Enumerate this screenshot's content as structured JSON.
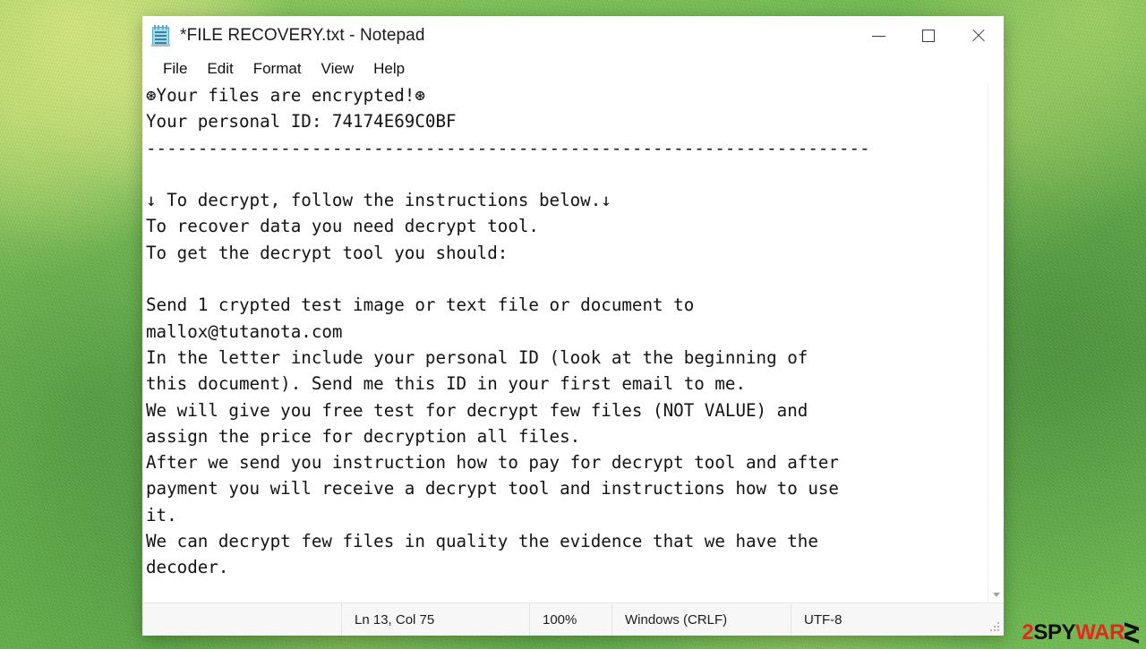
{
  "window": {
    "title": "*FILE RECOVERY.txt - Notepad",
    "icon": "notepad-icon",
    "controls": {
      "minimize": "minimize-icon",
      "maximize": "maximize-icon",
      "close": "close-icon"
    }
  },
  "menubar": {
    "items": [
      {
        "label": "File"
      },
      {
        "label": "Edit"
      },
      {
        "label": "Format"
      },
      {
        "label": "View"
      },
      {
        "label": "Help"
      }
    ]
  },
  "document": {
    "lines": [
      "⊛Your files are encrypted!⊛",
      "Your personal ID: 74174E69C0BF",
      "----------------------------------------------------------------------",
      "",
      "↓ To decrypt, follow the instructions below.↓",
      "To recover data you need decrypt tool.",
      "To get the decrypt tool you should:",
      "",
      "Send 1 crypted test image or text file or document to",
      "mallox@tutanota.com",
      "In the letter include your personal ID (look at the beginning of",
      "this document). Send me this ID in your first email to me.",
      "We will give you free test for decrypt few files (NOT VALUE) and",
      "assign the price for decryption all files.",
      "After we send you instruction how to pay for decrypt tool and after",
      "payment you will receive a decrypt tool and instructions how to use",
      "it.",
      "We can decrypt few files in quality the evidence that we have the",
      "decoder."
    ]
  },
  "statusbar": {
    "position": "Ln 13, Col 75",
    "zoom": "100%",
    "line_ending": "Windows (CRLF)",
    "encoding": "UTF-8"
  },
  "watermark": {
    "part1": "2",
    "part2": "SPY",
    "part3": "WAR",
    "part4": "E"
  },
  "colors": {
    "desktop_green": "#6cbb53",
    "window_white": "#ffffff",
    "text_black": "#131313",
    "watermark_red": "#e8251f",
    "watermark_black": "#101010"
  }
}
